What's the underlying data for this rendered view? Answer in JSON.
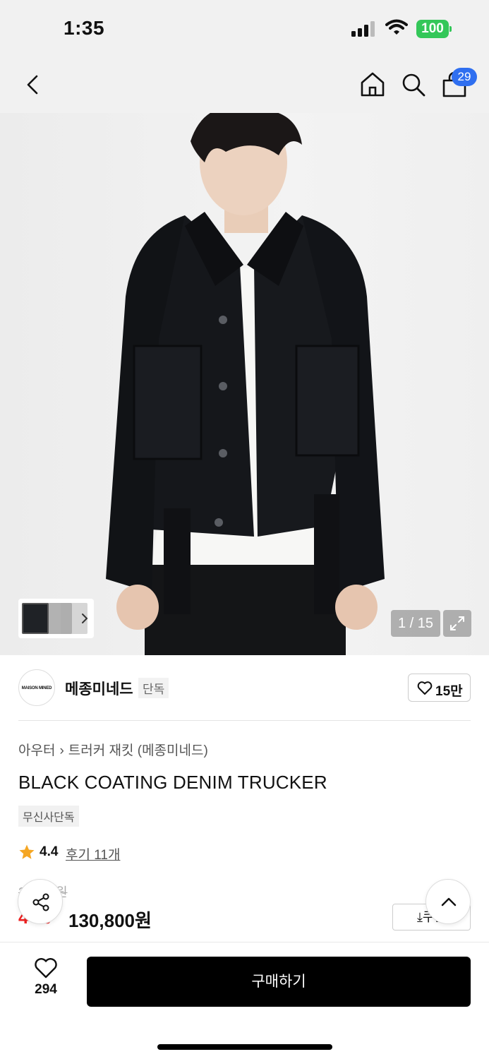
{
  "status_bar": {
    "time": "1:35",
    "battery": "100"
  },
  "nav": {
    "cart_count": "29"
  },
  "gallery": {
    "page_counter": "1 / 15"
  },
  "brand": {
    "logo_text": "MAISON MINED",
    "name": "메종미네드",
    "tag": "단독",
    "likes": "15만"
  },
  "product": {
    "breadcrumb": [
      "아우터",
      "트러커 재킷 (메종미네드)"
    ],
    "title": "BLACK COATING DENIM TRUCKER",
    "exclusive_tag": "무신사단독",
    "rating": "4.4",
    "reviews": "후기 11개",
    "original_price": "2--,-00원",
    "discount": "4-%",
    "price": "130,800원",
    "coupon_label": "⤓쿠폰"
  },
  "bottom_bar": {
    "wish_count": "294",
    "buy_label": "구매하기"
  },
  "colors": {
    "accent": "#2f6ff0",
    "discount": "#ee2222",
    "battery": "#34c759",
    "star": "#f5a623"
  },
  "icons": [
    "back-chevron-icon",
    "home-icon",
    "search-icon",
    "cart-icon",
    "expand-icon",
    "heart-icon",
    "star-icon",
    "share-icon",
    "chevron-up-icon"
  ]
}
